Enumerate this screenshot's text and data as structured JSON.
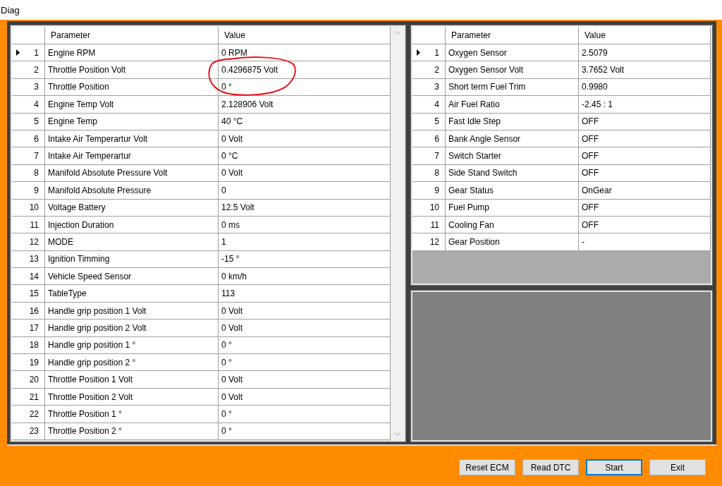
{
  "window": {
    "title": "Diag"
  },
  "left_table": {
    "columns": [
      "Parameter",
      "Value"
    ],
    "rows": [
      {
        "number": "1",
        "parameter": "Engine RPM",
        "value": "0 RPM",
        "selected": true
      },
      {
        "number": "2",
        "parameter": "Throttle Position Volt",
        "value": "0.4296875 Volt",
        "selected": false
      },
      {
        "number": "3",
        "parameter": "Throttle Position",
        "value": "0 °",
        "selected": false
      },
      {
        "number": "4",
        "parameter": "Engine Temp Volt",
        "value": "2.128906 Volt",
        "selected": false
      },
      {
        "number": "5",
        "parameter": "Engine Temp",
        "value": "40 °C",
        "selected": false
      },
      {
        "number": "6",
        "parameter": "Intake Air Temperartur Volt",
        "value": "0 Volt",
        "selected": false
      },
      {
        "number": "7",
        "parameter": "Intake Air Temperartur",
        "value": "0 °C",
        "selected": false
      },
      {
        "number": "8",
        "parameter": "Manifold Absolute Pressure Volt",
        "value": "0 Volt",
        "selected": false
      },
      {
        "number": "9",
        "parameter": "Manifold Absolute Pressure",
        "value": "0",
        "selected": false
      },
      {
        "number": "10",
        "parameter": "Voltage Battery",
        "value": "12.5 Volt",
        "selected": false
      },
      {
        "number": "11",
        "parameter": "Injection Duration",
        "value": "0 ms",
        "selected": false
      },
      {
        "number": "12",
        "parameter": "MODE",
        "value": "1",
        "selected": false
      },
      {
        "number": "13",
        "parameter": "Ignition Timming",
        "value": "-15 °",
        "selected": false
      },
      {
        "number": "14",
        "parameter": "Vehicle Speed Sensor",
        "value": "0 km/h",
        "selected": false
      },
      {
        "number": "15",
        "parameter": "TableType",
        "value": "113",
        "selected": false
      },
      {
        "number": "16",
        "parameter": "Handle grip position 1 Volt",
        "value": "0 Volt",
        "selected": false
      },
      {
        "number": "17",
        "parameter": "Handle grip position 2 Volt",
        "value": "0 Volt",
        "selected": false
      },
      {
        "number": "18",
        "parameter": "Handle grip position 1 °",
        "value": "0 °",
        "selected": false
      },
      {
        "number": "19",
        "parameter": "Handle grip position 2 °",
        "value": "0 °",
        "selected": false
      },
      {
        "number": "20",
        "parameter": "Throttle Position 1 Volt",
        "value": "0 Volt",
        "selected": false
      },
      {
        "number": "21",
        "parameter": "Throttle Position 2 Volt",
        "value": "0 Volt",
        "selected": false
      },
      {
        "number": "22",
        "parameter": "Throttle Position 1 °",
        "value": "0 °",
        "selected": false
      },
      {
        "number": "23",
        "parameter": "Throttle Position 2 °",
        "value": "0 °",
        "selected": false
      }
    ]
  },
  "right_table": {
    "columns": [
      "Parameter",
      "Value"
    ],
    "rows": [
      {
        "number": "1",
        "parameter": "Oxygen Sensor",
        "value": "2.5079",
        "selected": true
      },
      {
        "number": "2",
        "parameter": "Oxygen Sensor Volt",
        "value": "3.7652 Volt",
        "selected": false
      },
      {
        "number": "3",
        "parameter": "Short term Fuel Trim",
        "value": "0.9980",
        "selected": false
      },
      {
        "number": "4",
        "parameter": "Air Fuel Ratio",
        "value": "-2.45 : 1",
        "selected": false
      },
      {
        "number": "5",
        "parameter": "Fast Idle Step",
        "value": "OFF",
        "selected": false
      },
      {
        "number": "6",
        "parameter": "Bank Angle Sensor",
        "value": "OFF",
        "selected": false
      },
      {
        "number": "7",
        "parameter": "Switch Starter",
        "value": "OFF",
        "selected": false
      },
      {
        "number": "8",
        "parameter": "Side Stand Switch",
        "value": "OFF",
        "selected": false
      },
      {
        "number": "9",
        "parameter": "Gear Status",
        "value": "OnGear",
        "selected": false
      },
      {
        "number": "10",
        "parameter": "Fuel Pump",
        "value": "OFF",
        "selected": false
      },
      {
        "number": "11",
        "parameter": "Cooling Fan",
        "value": "OFF",
        "selected": false
      },
      {
        "number": "12",
        "parameter": "Gear Position",
        "value": "-",
        "selected": false
      }
    ]
  },
  "buttons": [
    {
      "label": "Reset ECM",
      "focused": false
    },
    {
      "label": "Read DTC",
      "focused": false
    },
    {
      "label": "Start",
      "focused": true
    },
    {
      "label": "Exit",
      "focused": false
    }
  ]
}
